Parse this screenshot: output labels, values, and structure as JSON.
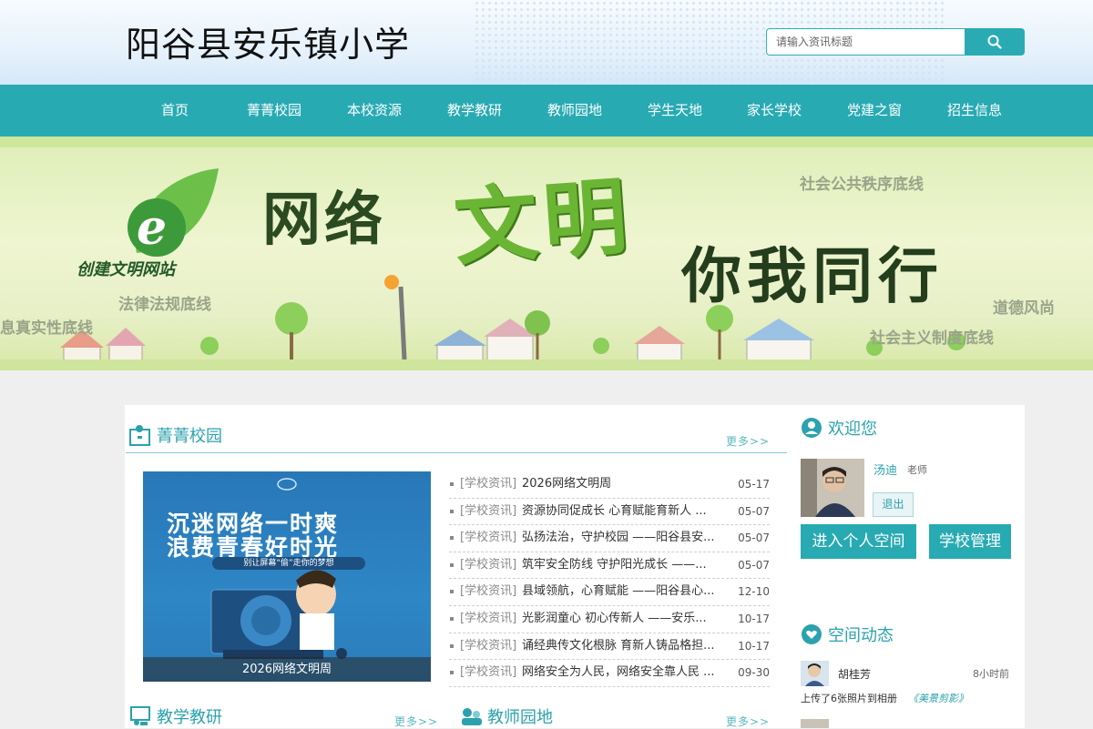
{
  "site": {
    "title": "阳谷县安乐镇小学"
  },
  "search": {
    "placeholder": "请输入资讯标题"
  },
  "nav": {
    "items": [
      "首页",
      "菁菁校园",
      "本校资源",
      "教学教研",
      "教师园地",
      "学生天地",
      "家长学校",
      "党建之窗",
      "招生信息"
    ]
  },
  "banner": {
    "headline_1": "网络",
    "headline_2": "文明",
    "headline_3": "你我同行",
    "logo_text": "创建文明网站",
    "bottom_lines": [
      "社会公共秩序底线",
      "法律法规底线",
      "道德风尚",
      "息真实性底线",
      "社会主义制度底线"
    ]
  },
  "campus": {
    "title": "菁菁校园",
    "more": "更多>>",
    "featured": {
      "caption": "2026网络文明周",
      "line_1": "沉迷网络一时爽",
      "line_2": "浪费青春好时光",
      "line_3": "别让屏幕“偷”走你的梦想"
    },
    "news": [
      {
        "tag": "[学校资讯]",
        "title": "2026网络文明周",
        "date": "05-17"
      },
      {
        "tag": "[学校资讯]",
        "title": "资源协同促成长 心育赋能育新人 ...",
        "date": "05-07"
      },
      {
        "tag": "[学校资讯]",
        "title": "弘扬法治，守护校园 ——阳谷县安...",
        "date": "05-07"
      },
      {
        "tag": "[学校资讯]",
        "title": "筑牢安全防线 守护阳光成长 ——...",
        "date": "05-07"
      },
      {
        "tag": "[学校资讯]",
        "title": "县域领航，心育赋能 ——阳谷县心...",
        "date": "12-10"
      },
      {
        "tag": "[学校资讯]",
        "title": "光影润童心 初心传新人 ——安乐...",
        "date": "10-17"
      },
      {
        "tag": "[学校资讯]",
        "title": "诵经典传文化根脉 育新人铸品格担...",
        "date": "10-17"
      },
      {
        "tag": "[学校资讯]",
        "title": "网络安全为人民，网络安全靠人民 ...",
        "date": "09-30"
      }
    ]
  },
  "teaching": {
    "title": "教学教研",
    "more": "更多>>"
  },
  "teachers": {
    "title": "教师园地",
    "more": "更多>>"
  },
  "welcome": {
    "title": "欢迎您",
    "user_name": "汤迪",
    "user_role": "老师",
    "logout": "退出",
    "personal_space": "进入个人空间",
    "school_admin": "学校管理"
  },
  "dynamics": {
    "title": "空间动态",
    "items": [
      {
        "name": "胡桂芳",
        "time": "8小时前",
        "action": "上传了6张照片到相册",
        "album": "《美景剪影》"
      }
    ]
  },
  "colors": {
    "accent": "#28aab3",
    "title_blue": "#2ba2ad"
  }
}
